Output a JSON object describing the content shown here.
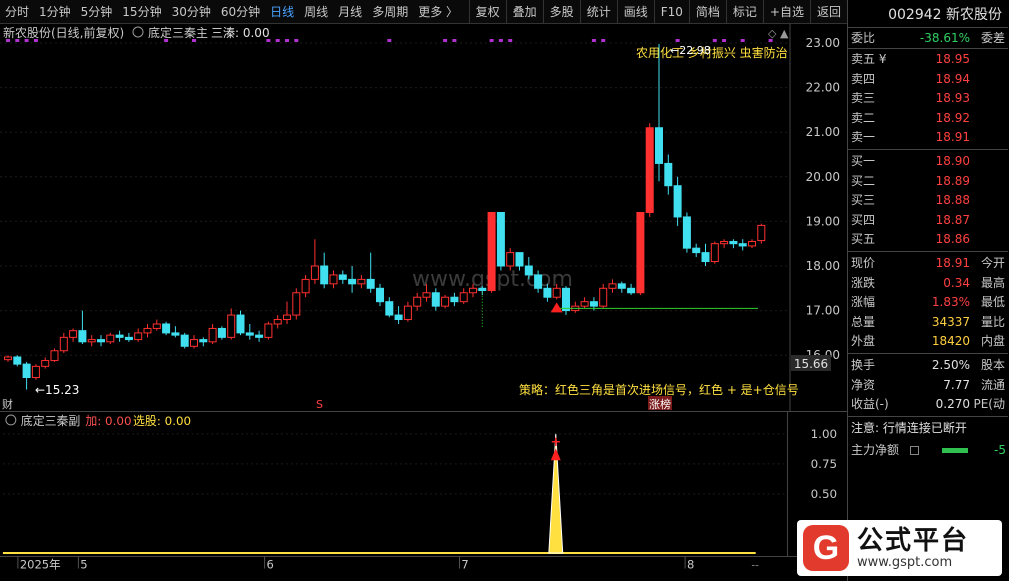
{
  "toolbar": {
    "periods": [
      "分时",
      "1分钟",
      "5分钟",
      "15分钟",
      "30分钟",
      "60分钟",
      "日线",
      "周线",
      "月线",
      "多周期",
      "更多 〉"
    ],
    "active_index": 6,
    "actions": [
      "复权",
      "叠加",
      "多股",
      "统计",
      "画线",
      "F10",
      "简档",
      "标记",
      "+自选",
      "返回"
    ]
  },
  "main": {
    "stock_title": "新农股份(日线,前复权)",
    "indicator_name": "底定三秦主",
    "indicator_value": "三溱: 0.00",
    "annotation_top": "农用化工 乡村振兴 虫害防治",
    "high_label": "←22.98",
    "low_label": "←15.23",
    "strategy_text": "策略：红色三角是首次进场信号，红色 + 是+仓信号",
    "price_tag": "15.66",
    "marker_left": "财",
    "marker_s": "S",
    "marker_zt": "涨榜",
    "watermark": "www.gspt.com",
    "y_ticks": [
      "23.00",
      "22.00",
      "21.00",
      "20.00",
      "19.00",
      "18.00",
      "17.00",
      "16.00"
    ]
  },
  "sub": {
    "indicator_name": "底定三秦副",
    "val_jia": "加: 0.00",
    "val_xuangu": "选股: 0.00",
    "y_ticks": [
      "1.00",
      "0.75",
      "0.50"
    ]
  },
  "bottom": {
    "x_labels": [
      "2025年",
      "5",
      "6",
      "7",
      "8"
    ],
    "scroll": "--"
  },
  "panel": {
    "code_name": "002942 新农股份",
    "weibi_label": "委比",
    "weibi_value": "-38.61%",
    "weicha_label": "委差",
    "asks": [
      {
        "label": "卖五 ¥",
        "price": "18.95"
      },
      {
        "label": "卖四",
        "price": "18.94"
      },
      {
        "label": "卖三",
        "price": "18.93"
      },
      {
        "label": "卖二",
        "price": "18.92"
      },
      {
        "label": "卖一",
        "price": "18.91"
      }
    ],
    "bids": [
      {
        "label": "买一",
        "price": "18.90"
      },
      {
        "label": "买二",
        "price": "18.89"
      },
      {
        "label": "买三",
        "price": "18.88"
      },
      {
        "label": "买四",
        "price": "18.87"
      },
      {
        "label": "买五",
        "price": "18.86"
      }
    ],
    "stats": [
      {
        "label": "现价",
        "value": "18.91",
        "right": "今开",
        "color": "#ff4040"
      },
      {
        "label": "涨跌",
        "value": "0.34",
        "right": "最高",
        "color": "#ff4040"
      },
      {
        "label": "涨幅",
        "value": "1.83%",
        "right": "最低",
        "color": "#ff4040"
      },
      {
        "label": "总量",
        "value": "34337",
        "right": "量比",
        "color": "#ffd040"
      },
      {
        "label": "外盘",
        "value": "18420",
        "right": "内盘",
        "color": "#ffd040"
      }
    ],
    "stats2": [
      {
        "label": "换手",
        "value": "2.50%",
        "right": "股本"
      },
      {
        "label": "净资",
        "value": "7.77",
        "right": "流通"
      },
      {
        "label": "收益(-)",
        "value": "0.270",
        "right": "PE(动"
      }
    ],
    "notice": "注意: 行情连接已断开",
    "capital_label": "主力净额",
    "capital_value": "-5"
  },
  "logo": {
    "mark": "G",
    "title": "公式平台",
    "url": "www.gspt.com"
  },
  "colors": {
    "up": "#ff3030",
    "down": "#40e0f0",
    "accent": "#4aa3ff",
    "signal": "#ffe040"
  },
  "chart_data": {
    "type": "candlestick",
    "candles": [
      [
        15.9,
        15.96,
        15.85,
        16.0
      ],
      [
        15.96,
        15.8,
        15.75,
        16.0
      ],
      [
        15.8,
        15.5,
        15.23,
        15.85
      ],
      [
        15.5,
        15.75,
        15.45,
        15.8
      ],
      [
        15.75,
        15.88,
        15.7,
        15.95
      ],
      [
        15.88,
        16.1,
        15.85,
        16.15
      ],
      [
        16.1,
        16.4,
        16.05,
        16.5
      ],
      [
        16.4,
        16.55,
        16.3,
        16.6
      ],
      [
        16.55,
        16.3,
        16.25,
        17.0
      ],
      [
        16.3,
        16.35,
        16.2,
        16.45
      ],
      [
        16.35,
        16.3,
        16.2,
        16.45
      ],
      [
        16.3,
        16.45,
        16.25,
        16.5
      ],
      [
        16.45,
        16.4,
        16.3,
        16.55
      ],
      [
        16.4,
        16.35,
        16.3,
        16.5
      ],
      [
        16.35,
        16.5,
        16.3,
        16.6
      ],
      [
        16.5,
        16.6,
        16.4,
        16.7
      ],
      [
        16.6,
        16.7,
        16.55,
        16.8
      ],
      [
        16.7,
        16.5,
        16.45,
        16.75
      ],
      [
        16.5,
        16.45,
        16.4,
        16.65
      ],
      [
        16.45,
        16.2,
        16.15,
        16.5
      ],
      [
        16.2,
        16.35,
        16.15,
        16.45
      ],
      [
        16.35,
        16.3,
        16.2,
        16.4
      ],
      [
        16.3,
        16.6,
        16.25,
        16.7
      ],
      [
        16.6,
        16.4,
        16.35,
        16.65
      ],
      [
        16.4,
        16.9,
        16.35,
        17.05
      ],
      [
        16.9,
        16.5,
        16.45,
        17.0
      ],
      [
        16.5,
        16.45,
        16.35,
        16.7
      ],
      [
        16.45,
        16.4,
        16.3,
        16.55
      ],
      [
        16.4,
        16.7,
        16.35,
        16.75
      ],
      [
        16.7,
        16.8,
        16.6,
        16.9
      ],
      [
        16.8,
        16.9,
        16.7,
        17.2
      ],
      [
        16.9,
        17.4,
        16.8,
        17.5
      ],
      [
        17.4,
        17.7,
        17.3,
        17.8
      ],
      [
        17.7,
        18.0,
        17.6,
        18.6
      ],
      [
        18.0,
        17.6,
        17.5,
        18.3
      ],
      [
        17.6,
        17.8,
        17.5,
        17.9
      ],
      [
        17.8,
        17.7,
        17.6,
        17.9
      ],
      [
        17.7,
        17.6,
        17.4,
        18.0
      ],
      [
        17.6,
        17.7,
        17.5,
        17.8
      ],
      [
        17.7,
        17.5,
        17.4,
        18.3
      ],
      [
        17.5,
        17.2,
        17.1,
        17.6
      ],
      [
        17.2,
        16.9,
        16.85,
        17.3
      ],
      [
        16.9,
        16.8,
        16.7,
        17.1
      ],
      [
        16.8,
        17.1,
        16.75,
        17.2
      ],
      [
        17.1,
        17.3,
        17.0,
        17.4
      ],
      [
        17.3,
        17.4,
        17.2,
        17.6
      ],
      [
        17.4,
        17.1,
        17.0,
        17.5
      ],
      [
        17.1,
        17.3,
        17.05,
        17.35
      ],
      [
        17.3,
        17.2,
        17.1,
        17.4
      ],
      [
        17.2,
        17.4,
        17.15,
        17.5
      ],
      [
        17.4,
        17.5,
        17.3,
        17.6
      ],
      [
        17.5,
        17.45,
        17.35,
        17.55
      ],
      [
        17.45,
        19.2,
        17.4,
        19.2
      ],
      [
        19.2,
        18.0,
        17.9,
        19.2
      ],
      [
        18.0,
        18.3,
        17.9,
        18.4
      ],
      [
        18.3,
        18.0,
        17.9,
        18.2
      ],
      [
        18.0,
        17.8,
        17.7,
        18.2
      ],
      [
        17.8,
        17.5,
        17.4,
        17.9
      ],
      [
        17.5,
        17.3,
        17.2,
        17.6
      ],
      [
        17.3,
        17.5,
        17.25,
        17.6
      ],
      [
        17.5,
        17.0,
        16.9,
        17.55
      ],
      [
        17.0,
        17.1,
        16.95,
        17.2
      ],
      [
        17.1,
        17.2,
        17.05,
        17.3
      ],
      [
        17.2,
        17.1,
        17.0,
        17.3
      ],
      [
        17.1,
        17.5,
        17.05,
        17.6
      ],
      [
        17.5,
        17.6,
        17.4,
        17.7
      ],
      [
        17.6,
        17.5,
        17.4,
        17.65
      ],
      [
        17.5,
        17.4,
        17.35,
        17.6
      ],
      [
        17.4,
        19.2,
        17.35,
        19.2
      ],
      [
        19.2,
        21.1,
        19.1,
        21.2
      ],
      [
        21.1,
        20.3,
        19.9,
        22.98
      ],
      [
        20.3,
        19.8,
        19.6,
        20.5
      ],
      [
        19.8,
        19.1,
        18.9,
        20.0
      ],
      [
        19.1,
        18.4,
        18.3,
        19.2
      ],
      [
        18.4,
        18.3,
        18.2,
        18.5
      ],
      [
        18.3,
        18.1,
        18.0,
        18.5
      ],
      [
        18.1,
        18.5,
        18.05,
        18.55
      ],
      [
        18.5,
        18.55,
        18.4,
        18.6
      ],
      [
        18.55,
        18.5,
        18.4,
        18.6
      ],
      [
        18.5,
        18.45,
        18.35,
        18.6
      ],
      [
        18.45,
        18.55,
        18.4,
        18.6
      ],
      [
        18.57,
        18.91,
        18.5,
        18.95
      ]
    ],
    "signal_triangle_index": 59,
    "signal_line_price": 17.05,
    "ylim": [
      15.6,
      23.2
    ]
  }
}
